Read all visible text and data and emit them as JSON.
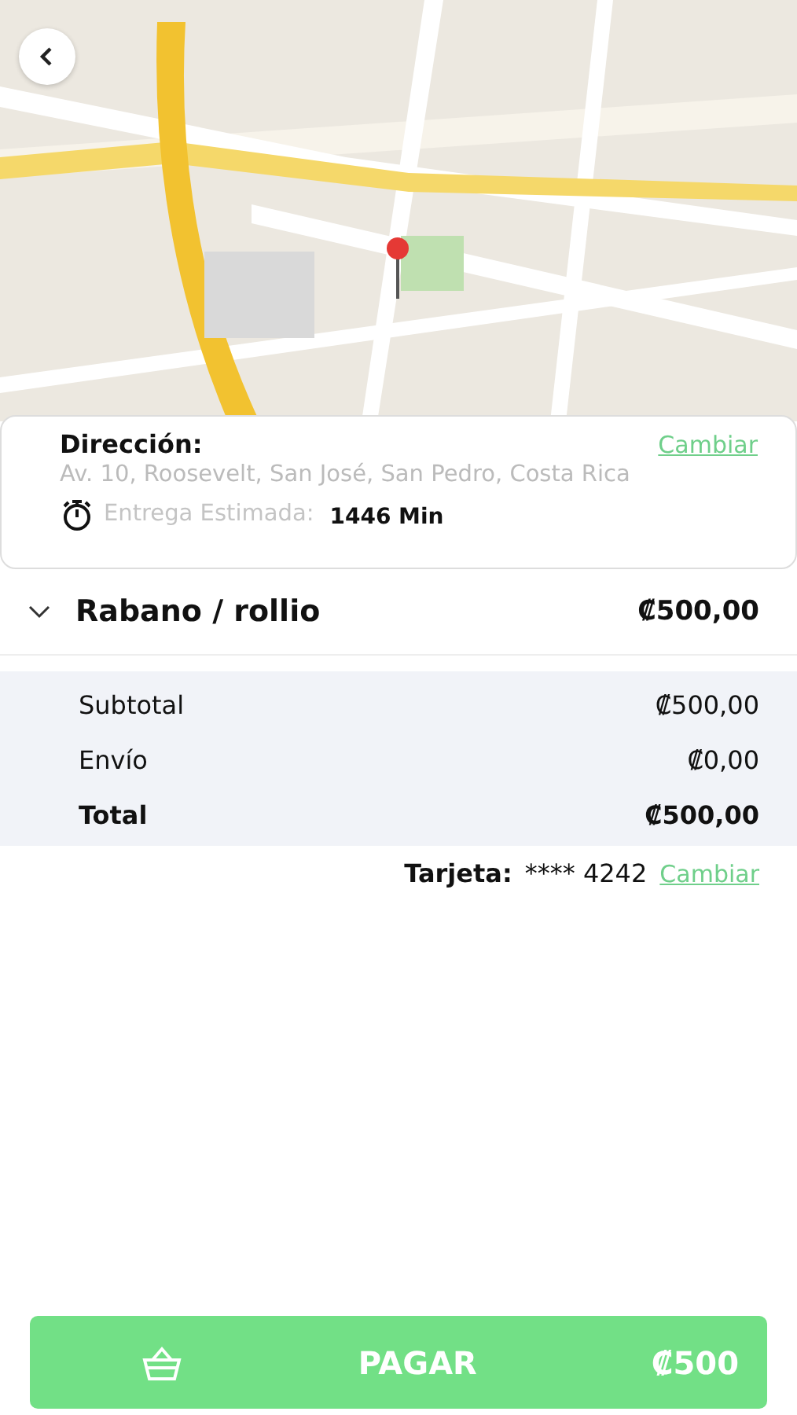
{
  "address": {
    "label": "Dirección:",
    "change_link": "Cambiar",
    "value": "Av. 10, Roosevelt, San José, San Pedro, Costa Rica",
    "eta_label": "Entrega Estimada:",
    "eta_value": "1446 Min"
  },
  "items": [
    {
      "name": "Rabano / rollio",
      "price": "₡500,00",
      "expanded": true
    }
  ],
  "summary": [
    {
      "label": "Subtotal",
      "value": "₡500,00",
      "kind": "normal"
    },
    {
      "label": "Envío",
      "value": "₡0,00",
      "kind": "normal"
    },
    {
      "label": "Total",
      "value": "₡500,00",
      "kind": "total"
    }
  ],
  "card": {
    "label": "Tarjeta:",
    "number": "**** 4242",
    "change_link": "Cambiar"
  },
  "pay_button": {
    "label": "PAGAR",
    "amount": "₡500"
  }
}
